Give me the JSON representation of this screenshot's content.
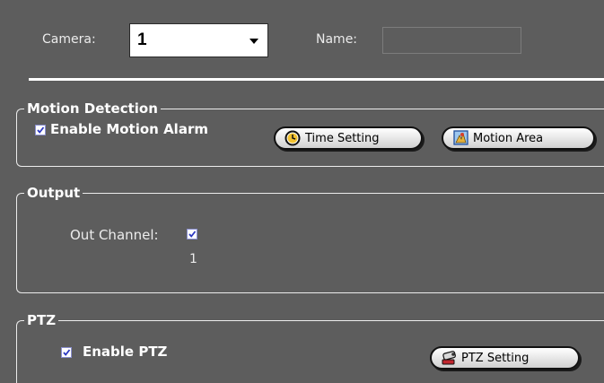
{
  "camera": {
    "label": "Camera:",
    "value": "1"
  },
  "name_field": {
    "label": "Name:",
    "value": ""
  },
  "motion_detection": {
    "title": "Motion Detection",
    "enable_label": "Enable Motion Alarm",
    "enable_checked": true,
    "time_setting_label": "Time Setting",
    "time_setting_icon": "clock-icon",
    "motion_area_label": "Motion Area",
    "motion_area_icon": "motion-area-icon"
  },
  "output": {
    "title": "Output",
    "out_channel_label": "Out Channel:",
    "out_channel_checked": true,
    "channel_number": "1"
  },
  "ptz": {
    "title": "PTZ",
    "enable_label": "Enable PTZ",
    "enable_checked": true,
    "setting_label": "PTZ Setting",
    "setting_icon": "ptz-camera-icon"
  },
  "colors": {
    "panel_bg": "#5d5d5d",
    "text": "#ececec",
    "divider": "#ffffff"
  }
}
